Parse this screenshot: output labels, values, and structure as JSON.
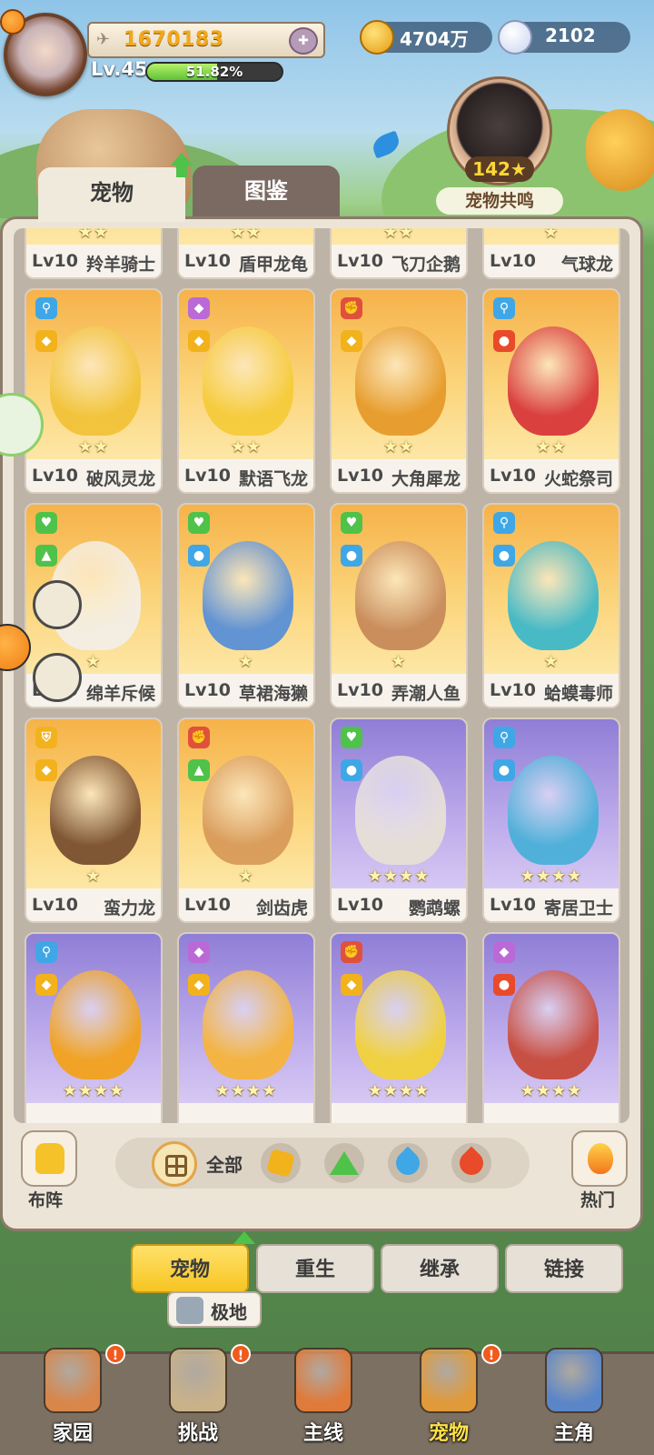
{
  "player": {
    "exp": "1670183",
    "level": "Lv.45",
    "progress": "51.82%",
    "progress_fraction": 0.5182
  },
  "currency": {
    "gold": "4704万",
    "gems": "2102"
  },
  "resonance": {
    "count": "142",
    "label": "宠物共鸣"
  },
  "tabs": {
    "pets": "宠物",
    "catalog": "图鉴"
  },
  "cards": [
    {
      "lv": "Lv10",
      "name": "羚羊骑士",
      "bg": "orange",
      "stars": 2
    },
    {
      "lv": "Lv10",
      "name": "盾甲龙龟",
      "bg": "orange",
      "stars": 2
    },
    {
      "lv": "Lv10",
      "name": "飞刀企鹅",
      "bg": "orange",
      "stars": 2
    },
    {
      "lv": "Lv10",
      "name": "气球龙",
      "bg": "orange",
      "stars": 1
    },
    {
      "lv": "Lv10",
      "name": "破风灵龙",
      "bg": "orange",
      "stars": "★★",
      "b1": "⚲",
      "b1c": "#3fa7e6",
      "b2": "◆",
      "b2c": "#f2b21c",
      "pet": "#f2c33a"
    },
    {
      "lv": "Lv10",
      "name": "默语飞龙",
      "bg": "orange",
      "stars": "★★",
      "b1": "◆",
      "b1c": "#b96ad6",
      "b2": "◆",
      "b2c": "#f2b21c",
      "pet": "#f6cb3b"
    },
    {
      "lv": "Lv10",
      "name": "大角犀龙",
      "bg": "orange",
      "stars": "★★",
      "b1": "✊",
      "b1c": "#e0503c",
      "b2": "◆",
      "b2c": "#f2b21c",
      "pet": "#e69a2a"
    },
    {
      "lv": "Lv10",
      "name": "火蛇祭司",
      "bg": "orange",
      "stars": "★★",
      "b1": "⚲",
      "b1c": "#3fa7e6",
      "b2": "●",
      "b2c": "#e84a2a",
      "pet": "#d8383a"
    },
    {
      "lv": "Lv10",
      "name": "绵羊斥候",
      "bg": "orange",
      "stars": "★",
      "b1": "♥",
      "b1c": "#4fc24a",
      "b2": "▲",
      "b2c": "#4fc24a",
      "pet": "#f3eee6"
    },
    {
      "lv": "Lv10",
      "name": "草裙海獭",
      "bg": "orange",
      "stars": "★",
      "b1": "♥",
      "b1c": "#4fc24a",
      "b2": "●",
      "b2c": "#3fa7e6",
      "pet": "#5a8fd6"
    },
    {
      "lv": "Lv10",
      "name": "弄潮人鱼",
      "bg": "orange",
      "stars": "★",
      "b1": "♥",
      "b1c": "#4fc24a",
      "b2": "●",
      "b2c": "#3fa7e6",
      "pet": "#c78a5a"
    },
    {
      "lv": "Lv10",
      "name": "蛤蟆毒师",
      "bg": "orange",
      "stars": "★",
      "b1": "⚲",
      "b1c": "#3fa7e6",
      "b2": "●",
      "b2c": "#3fa7e6",
      "pet": "#3fb8c8"
    },
    {
      "lv": "Lv10",
      "name": "蛮力龙",
      "bg": "orange",
      "stars": "★",
      "b1": "⛨",
      "b1c": "#f2b21c",
      "b2": "◆",
      "b2c": "#f2b21c",
      "pet": "#7a5030"
    },
    {
      "lv": "Lv10",
      "name": "剑齿虎",
      "bg": "orange",
      "stars": "★",
      "b1": "✊",
      "b1c": "#e0503c",
      "b2": "▲",
      "b2c": "#4fc24a",
      "pet": "#d89a5a"
    },
    {
      "lv": "Lv10",
      "name": "鹦鹉螺",
      "bg": "purple",
      "stars": "★★★★",
      "b1": "♥",
      "b1c": "#4fc24a",
      "b2": "●",
      "b2c": "#3fa7e6",
      "pet": "#e6e0d6"
    },
    {
      "lv": "Lv10",
      "name": "寄居卫士",
      "bg": "purple",
      "stars": "★★★★",
      "b1": "⚲",
      "b1c": "#3fa7e6",
      "b2": "●",
      "b2c": "#3fa7e6",
      "pet": "#4ab0d8"
    },
    {
      "lv": "",
      "name": "",
      "bg": "purple",
      "stars": "★★★★",
      "b1": "⚲",
      "b1c": "#3fa7e6",
      "b2": "◆",
      "b2c": "#f2b21c",
      "pet": "#f2a21c"
    },
    {
      "lv": "",
      "name": "",
      "bg": "purple",
      "stars": "★★★★",
      "b1": "◆",
      "b1c": "#b96ad6",
      "b2": "◆",
      "b2c": "#f2b21c",
      "pet": "#f6b43a"
    },
    {
      "lv": "",
      "name": "",
      "bg": "purple",
      "stars": "★★★★",
      "b1": "✊",
      "b1c": "#e0503c",
      "b2": "◆",
      "b2c": "#f2b21c",
      "pet": "#f2d23a"
    },
    {
      "lv": "",
      "name": "",
      "bg": "purple",
      "stars": "★★★★",
      "b1": "◆",
      "b1c": "#b96ad6",
      "b2": "●",
      "b2c": "#e84a2a",
      "pet": "#c84a3a"
    }
  ],
  "filters": {
    "formation": "布阵",
    "all": "全部",
    "hot": "热门"
  },
  "subtabs": [
    "宠物",
    "重生",
    "继承",
    "链接"
  ],
  "tooltip": "极地",
  "nav": [
    {
      "label": "家园",
      "color": "#d8864a",
      "dot": "!"
    },
    {
      "label": "挑战",
      "color": "#c9b18a",
      "dot": "!"
    },
    {
      "label": "主线",
      "color": "#e07a3a",
      "dot": ""
    },
    {
      "label": "宠物",
      "color": "#e09a3a",
      "dot": "!"
    },
    {
      "label": "主角",
      "color": "#5a86c8",
      "dot": ""
    }
  ]
}
